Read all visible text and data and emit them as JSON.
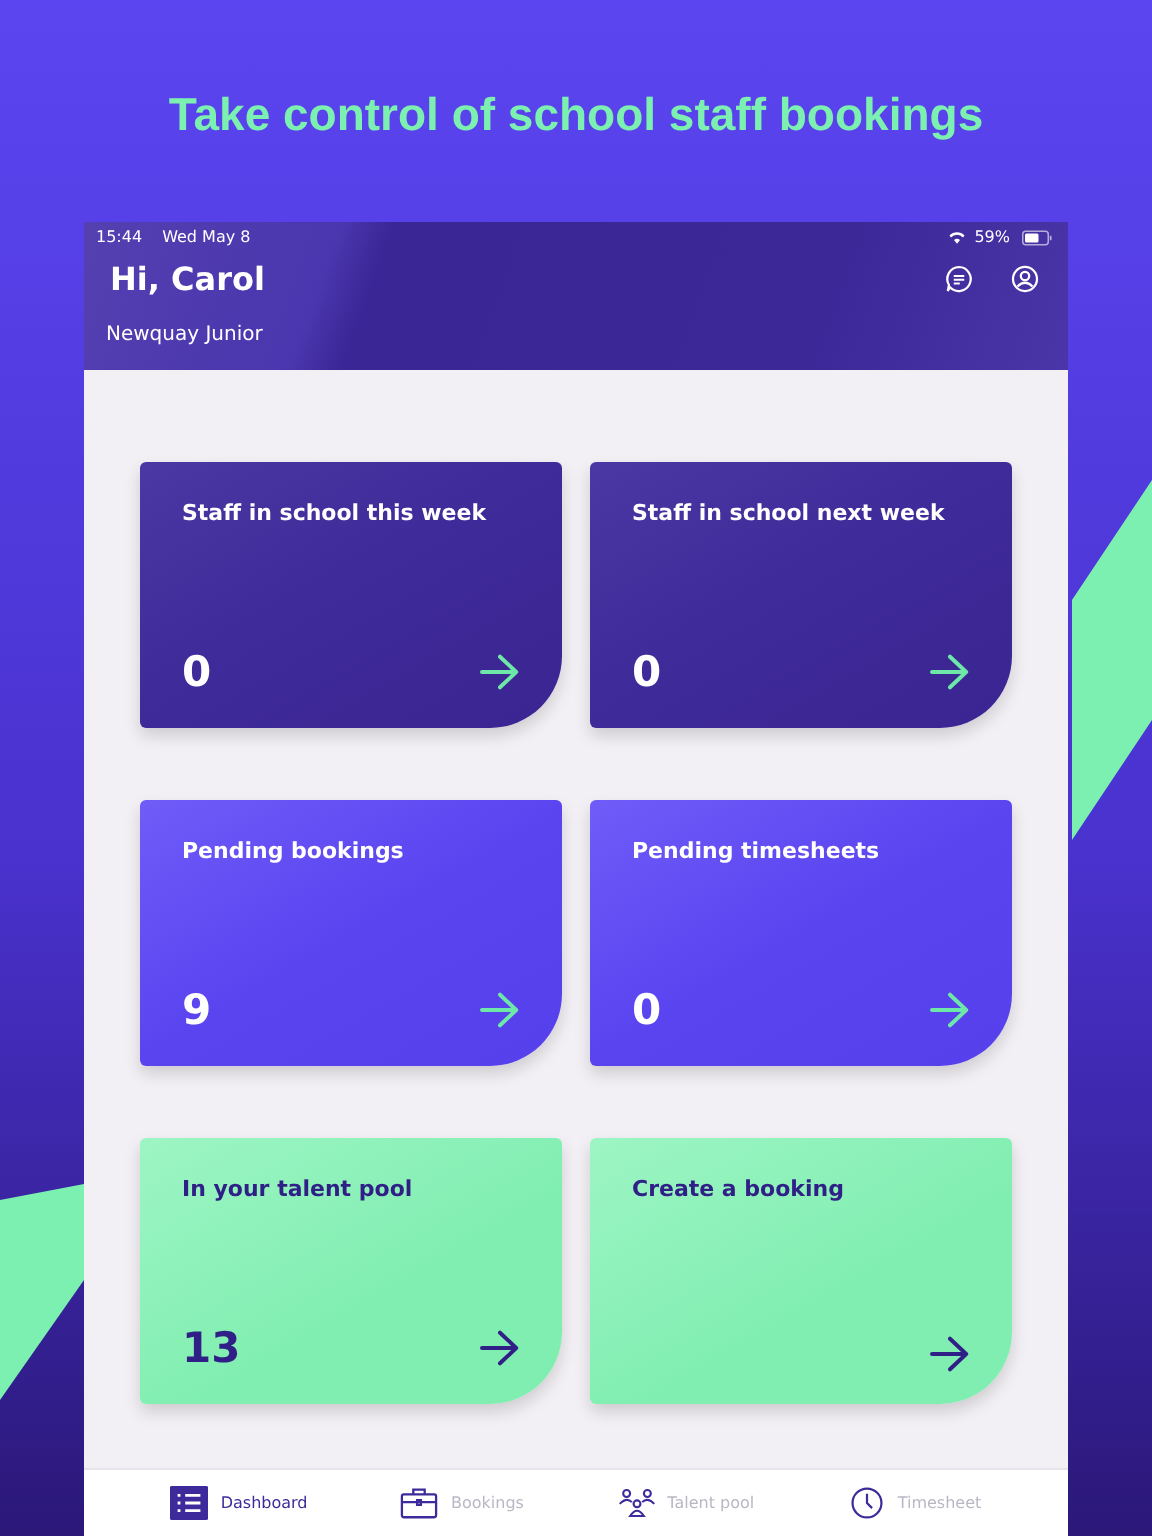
{
  "headline": "Take control of school staff bookings",
  "status_bar": {
    "time": "15:44",
    "date": "Wed May 8",
    "battery": "59%"
  },
  "header": {
    "greeting": "Hi, Carol",
    "school": "Newquay Junior"
  },
  "cards": [
    {
      "kind": "dark",
      "title": "Staff in school this week",
      "count": "0"
    },
    {
      "kind": "dark",
      "title": "Staff in school next week",
      "count": "0"
    },
    {
      "kind": "violet",
      "title": "Pending bookings",
      "count": "9"
    },
    {
      "kind": "violet",
      "title": "Pending timesheets",
      "count": "0"
    },
    {
      "kind": "mint",
      "title": "In your talent pool",
      "count": "13"
    },
    {
      "kind": "mint",
      "title": "Create a booking"
    }
  ],
  "tabs": [
    {
      "kind": "list",
      "label": "Dashboard",
      "selected": true
    },
    {
      "kind": "briefcase",
      "label": "Bookings",
      "selected": false
    },
    {
      "kind": "people",
      "label": "Talent pool",
      "selected": false
    },
    {
      "kind": "clock",
      "label": "Timesheet",
      "selected": false
    }
  ]
}
